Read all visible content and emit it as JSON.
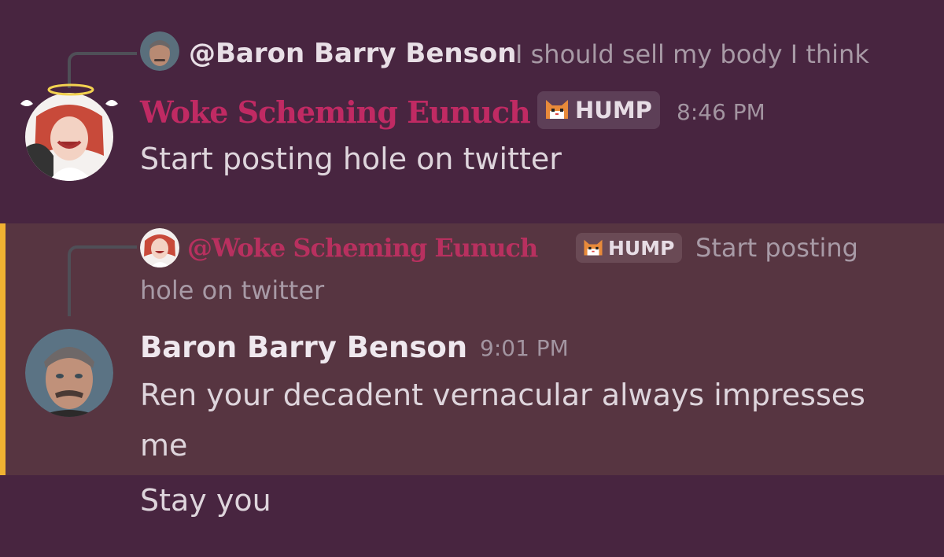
{
  "messages": [
    {
      "reply": {
        "name": "@Baron Barry Benson",
        "text": "I should sell my body I think"
      },
      "author": "Woke Scheming Eunuch",
      "tag": "HUMP",
      "time": "8:46 PM",
      "lines": [
        "Start posting hole on twitter"
      ]
    },
    {
      "reply": {
        "name": "@Woke Scheming Eunuch",
        "tag": "HUMP",
        "text_line1": "Start posting",
        "text_line2": "hole on twitter"
      },
      "author": "Baron Barry Benson",
      "time": "9:01 PM",
      "lines": [
        "Ren your decadent vernacular always impresses",
        "me"
      ]
    },
    {
      "lines": [
        "Stay you"
      ]
    }
  ],
  "colors": {
    "background": "#482540",
    "highlight_background": "#573541",
    "mention_bar": "#f0b232",
    "pink_username": "#c02a63"
  }
}
